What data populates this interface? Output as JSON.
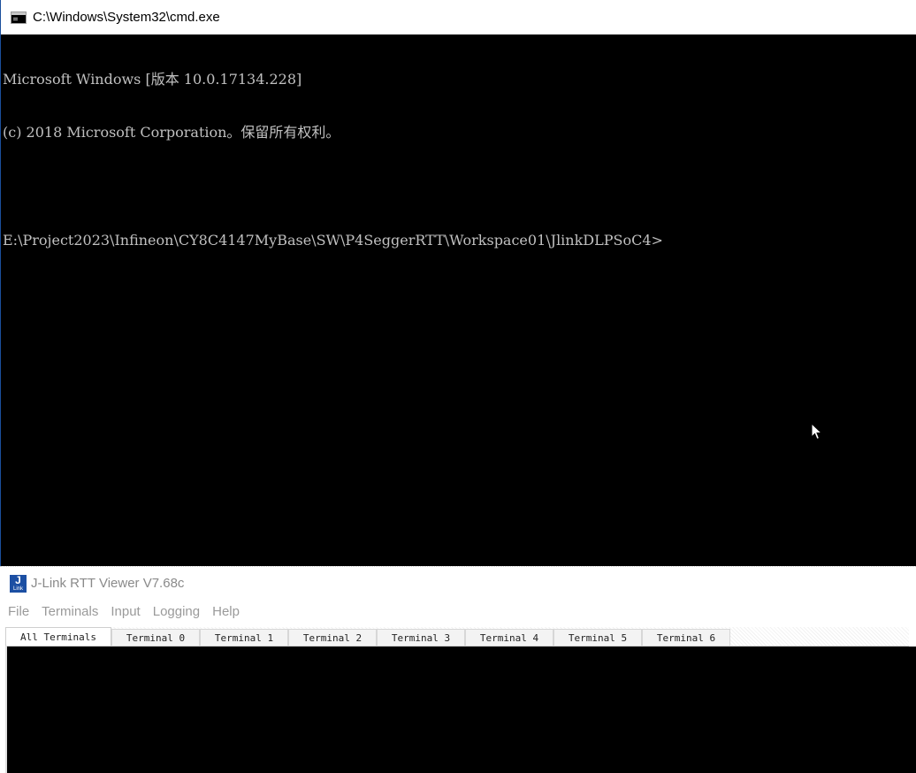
{
  "cmd": {
    "title": "C:\\Windows\\System32\\cmd.exe",
    "console_lines": [
      "Microsoft Windows [版本 10.0.17134.228]",
      "(c) 2018 Microsoft Corporation。保留所有权利。",
      "",
      "E:\\Project2023\\Infineon\\CY8C4147MyBase\\SW\\P4SeggerRTT\\Workspace01\\JlinkDLPSoC4>"
    ]
  },
  "rtt": {
    "title": "J-Link RTT Viewer V7.68c",
    "logo_text": "J",
    "logo_subtext": "Link",
    "menu": [
      "File",
      "Terminals",
      "Input",
      "Logging",
      "Help"
    ],
    "tabs": [
      "All Terminals",
      "Terminal 0",
      "Terminal 1",
      "Terminal 2",
      "Terminal 3",
      "Terminal 4",
      "Terminal 5",
      "Terminal 6"
    ],
    "active_tab": "All Terminals"
  },
  "colors": {
    "console_bg": "#000000",
    "console_text": "#c0c0c0",
    "rtt_logo": "#1c4fa3"
  },
  "icons": {
    "cmd": "cmd-window-icon",
    "rtt": "jlink-logo-icon",
    "pointer": "mouse-pointer-icon"
  }
}
